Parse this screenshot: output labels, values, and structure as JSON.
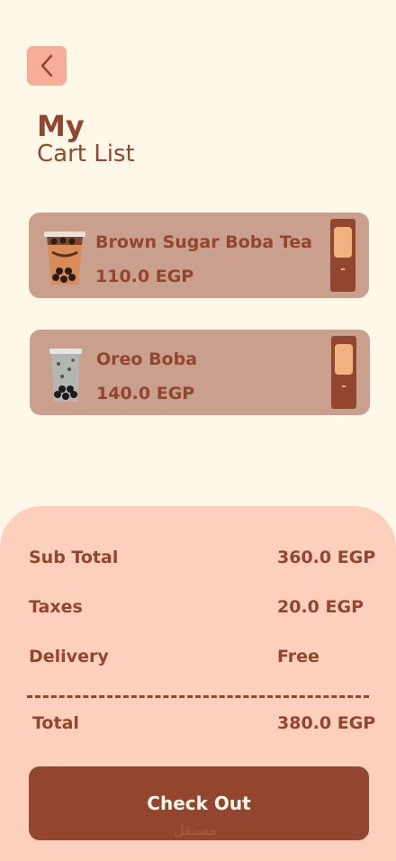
{
  "header": {
    "title_bold": "My",
    "title_sub": "Cart List"
  },
  "cart": {
    "items": [
      {
        "name": "Brown Sugar Boba Tea",
        "price": "110.0 EGP",
        "minus": "-"
      },
      {
        "name": "Oreo Boba",
        "price": "140.0 EGP",
        "minus": "-"
      }
    ]
  },
  "summary": {
    "subtotal_label": "Sub Total",
    "subtotal_value": "360.0 EGP",
    "taxes_label": "Taxes",
    "taxes_value": "20.0 EGP",
    "delivery_label": "Delivery",
    "delivery_value": "Free",
    "total_label": "Total",
    "total_value": "380.0 EGP",
    "checkout_label": "Check Out"
  },
  "watermark": "مستقل",
  "colors": {
    "bg": "#fff7e7",
    "accent": "#93462f",
    "card": "#c8a08d",
    "summary": "#fdcfbd",
    "back": "#f8ad98",
    "qty": "#f0b37f"
  },
  "icons": {
    "back": "chevron-left-icon"
  }
}
